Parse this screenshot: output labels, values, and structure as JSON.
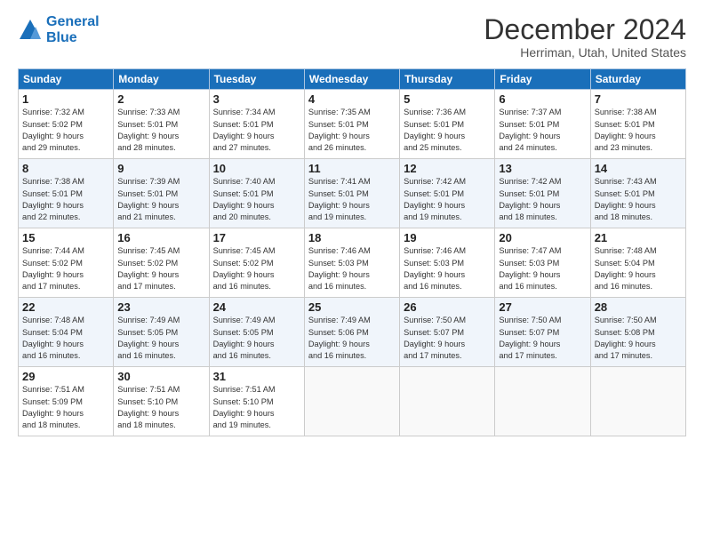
{
  "logo": {
    "line1": "General",
    "line2": "Blue"
  },
  "title": "December 2024",
  "subtitle": "Herriman, Utah, United States",
  "days_header": [
    "Sunday",
    "Monday",
    "Tuesday",
    "Wednesday",
    "Thursday",
    "Friday",
    "Saturday"
  ],
  "weeks": [
    [
      {
        "day": "1",
        "info": "Sunrise: 7:32 AM\nSunset: 5:02 PM\nDaylight: 9 hours\nand 29 minutes."
      },
      {
        "day": "2",
        "info": "Sunrise: 7:33 AM\nSunset: 5:01 PM\nDaylight: 9 hours\nand 28 minutes."
      },
      {
        "day": "3",
        "info": "Sunrise: 7:34 AM\nSunset: 5:01 PM\nDaylight: 9 hours\nand 27 minutes."
      },
      {
        "day": "4",
        "info": "Sunrise: 7:35 AM\nSunset: 5:01 PM\nDaylight: 9 hours\nand 26 minutes."
      },
      {
        "day": "5",
        "info": "Sunrise: 7:36 AM\nSunset: 5:01 PM\nDaylight: 9 hours\nand 25 minutes."
      },
      {
        "day": "6",
        "info": "Sunrise: 7:37 AM\nSunset: 5:01 PM\nDaylight: 9 hours\nand 24 minutes."
      },
      {
        "day": "7",
        "info": "Sunrise: 7:38 AM\nSunset: 5:01 PM\nDaylight: 9 hours\nand 23 minutes."
      }
    ],
    [
      {
        "day": "8",
        "info": "Sunrise: 7:38 AM\nSunset: 5:01 PM\nDaylight: 9 hours\nand 22 minutes."
      },
      {
        "day": "9",
        "info": "Sunrise: 7:39 AM\nSunset: 5:01 PM\nDaylight: 9 hours\nand 21 minutes."
      },
      {
        "day": "10",
        "info": "Sunrise: 7:40 AM\nSunset: 5:01 PM\nDaylight: 9 hours\nand 20 minutes."
      },
      {
        "day": "11",
        "info": "Sunrise: 7:41 AM\nSunset: 5:01 PM\nDaylight: 9 hours\nand 19 minutes."
      },
      {
        "day": "12",
        "info": "Sunrise: 7:42 AM\nSunset: 5:01 PM\nDaylight: 9 hours\nand 19 minutes."
      },
      {
        "day": "13",
        "info": "Sunrise: 7:42 AM\nSunset: 5:01 PM\nDaylight: 9 hours\nand 18 minutes."
      },
      {
        "day": "14",
        "info": "Sunrise: 7:43 AM\nSunset: 5:01 PM\nDaylight: 9 hours\nand 18 minutes."
      }
    ],
    [
      {
        "day": "15",
        "info": "Sunrise: 7:44 AM\nSunset: 5:02 PM\nDaylight: 9 hours\nand 17 minutes."
      },
      {
        "day": "16",
        "info": "Sunrise: 7:45 AM\nSunset: 5:02 PM\nDaylight: 9 hours\nand 17 minutes."
      },
      {
        "day": "17",
        "info": "Sunrise: 7:45 AM\nSunset: 5:02 PM\nDaylight: 9 hours\nand 16 minutes."
      },
      {
        "day": "18",
        "info": "Sunrise: 7:46 AM\nSunset: 5:03 PM\nDaylight: 9 hours\nand 16 minutes."
      },
      {
        "day": "19",
        "info": "Sunrise: 7:46 AM\nSunset: 5:03 PM\nDaylight: 9 hours\nand 16 minutes."
      },
      {
        "day": "20",
        "info": "Sunrise: 7:47 AM\nSunset: 5:03 PM\nDaylight: 9 hours\nand 16 minutes."
      },
      {
        "day": "21",
        "info": "Sunrise: 7:48 AM\nSunset: 5:04 PM\nDaylight: 9 hours\nand 16 minutes."
      }
    ],
    [
      {
        "day": "22",
        "info": "Sunrise: 7:48 AM\nSunset: 5:04 PM\nDaylight: 9 hours\nand 16 minutes."
      },
      {
        "day": "23",
        "info": "Sunrise: 7:49 AM\nSunset: 5:05 PM\nDaylight: 9 hours\nand 16 minutes."
      },
      {
        "day": "24",
        "info": "Sunrise: 7:49 AM\nSunset: 5:05 PM\nDaylight: 9 hours\nand 16 minutes."
      },
      {
        "day": "25",
        "info": "Sunrise: 7:49 AM\nSunset: 5:06 PM\nDaylight: 9 hours\nand 16 minutes."
      },
      {
        "day": "26",
        "info": "Sunrise: 7:50 AM\nSunset: 5:07 PM\nDaylight: 9 hours\nand 17 minutes."
      },
      {
        "day": "27",
        "info": "Sunrise: 7:50 AM\nSunset: 5:07 PM\nDaylight: 9 hours\nand 17 minutes."
      },
      {
        "day": "28",
        "info": "Sunrise: 7:50 AM\nSunset: 5:08 PM\nDaylight: 9 hours\nand 17 minutes."
      }
    ],
    [
      {
        "day": "29",
        "info": "Sunrise: 7:51 AM\nSunset: 5:09 PM\nDaylight: 9 hours\nand 18 minutes."
      },
      {
        "day": "30",
        "info": "Sunrise: 7:51 AM\nSunset: 5:10 PM\nDaylight: 9 hours\nand 18 minutes."
      },
      {
        "day": "31",
        "info": "Sunrise: 7:51 AM\nSunset: 5:10 PM\nDaylight: 9 hours\nand 19 minutes."
      },
      {
        "day": "",
        "info": ""
      },
      {
        "day": "",
        "info": ""
      },
      {
        "day": "",
        "info": ""
      },
      {
        "day": "",
        "info": ""
      }
    ]
  ]
}
